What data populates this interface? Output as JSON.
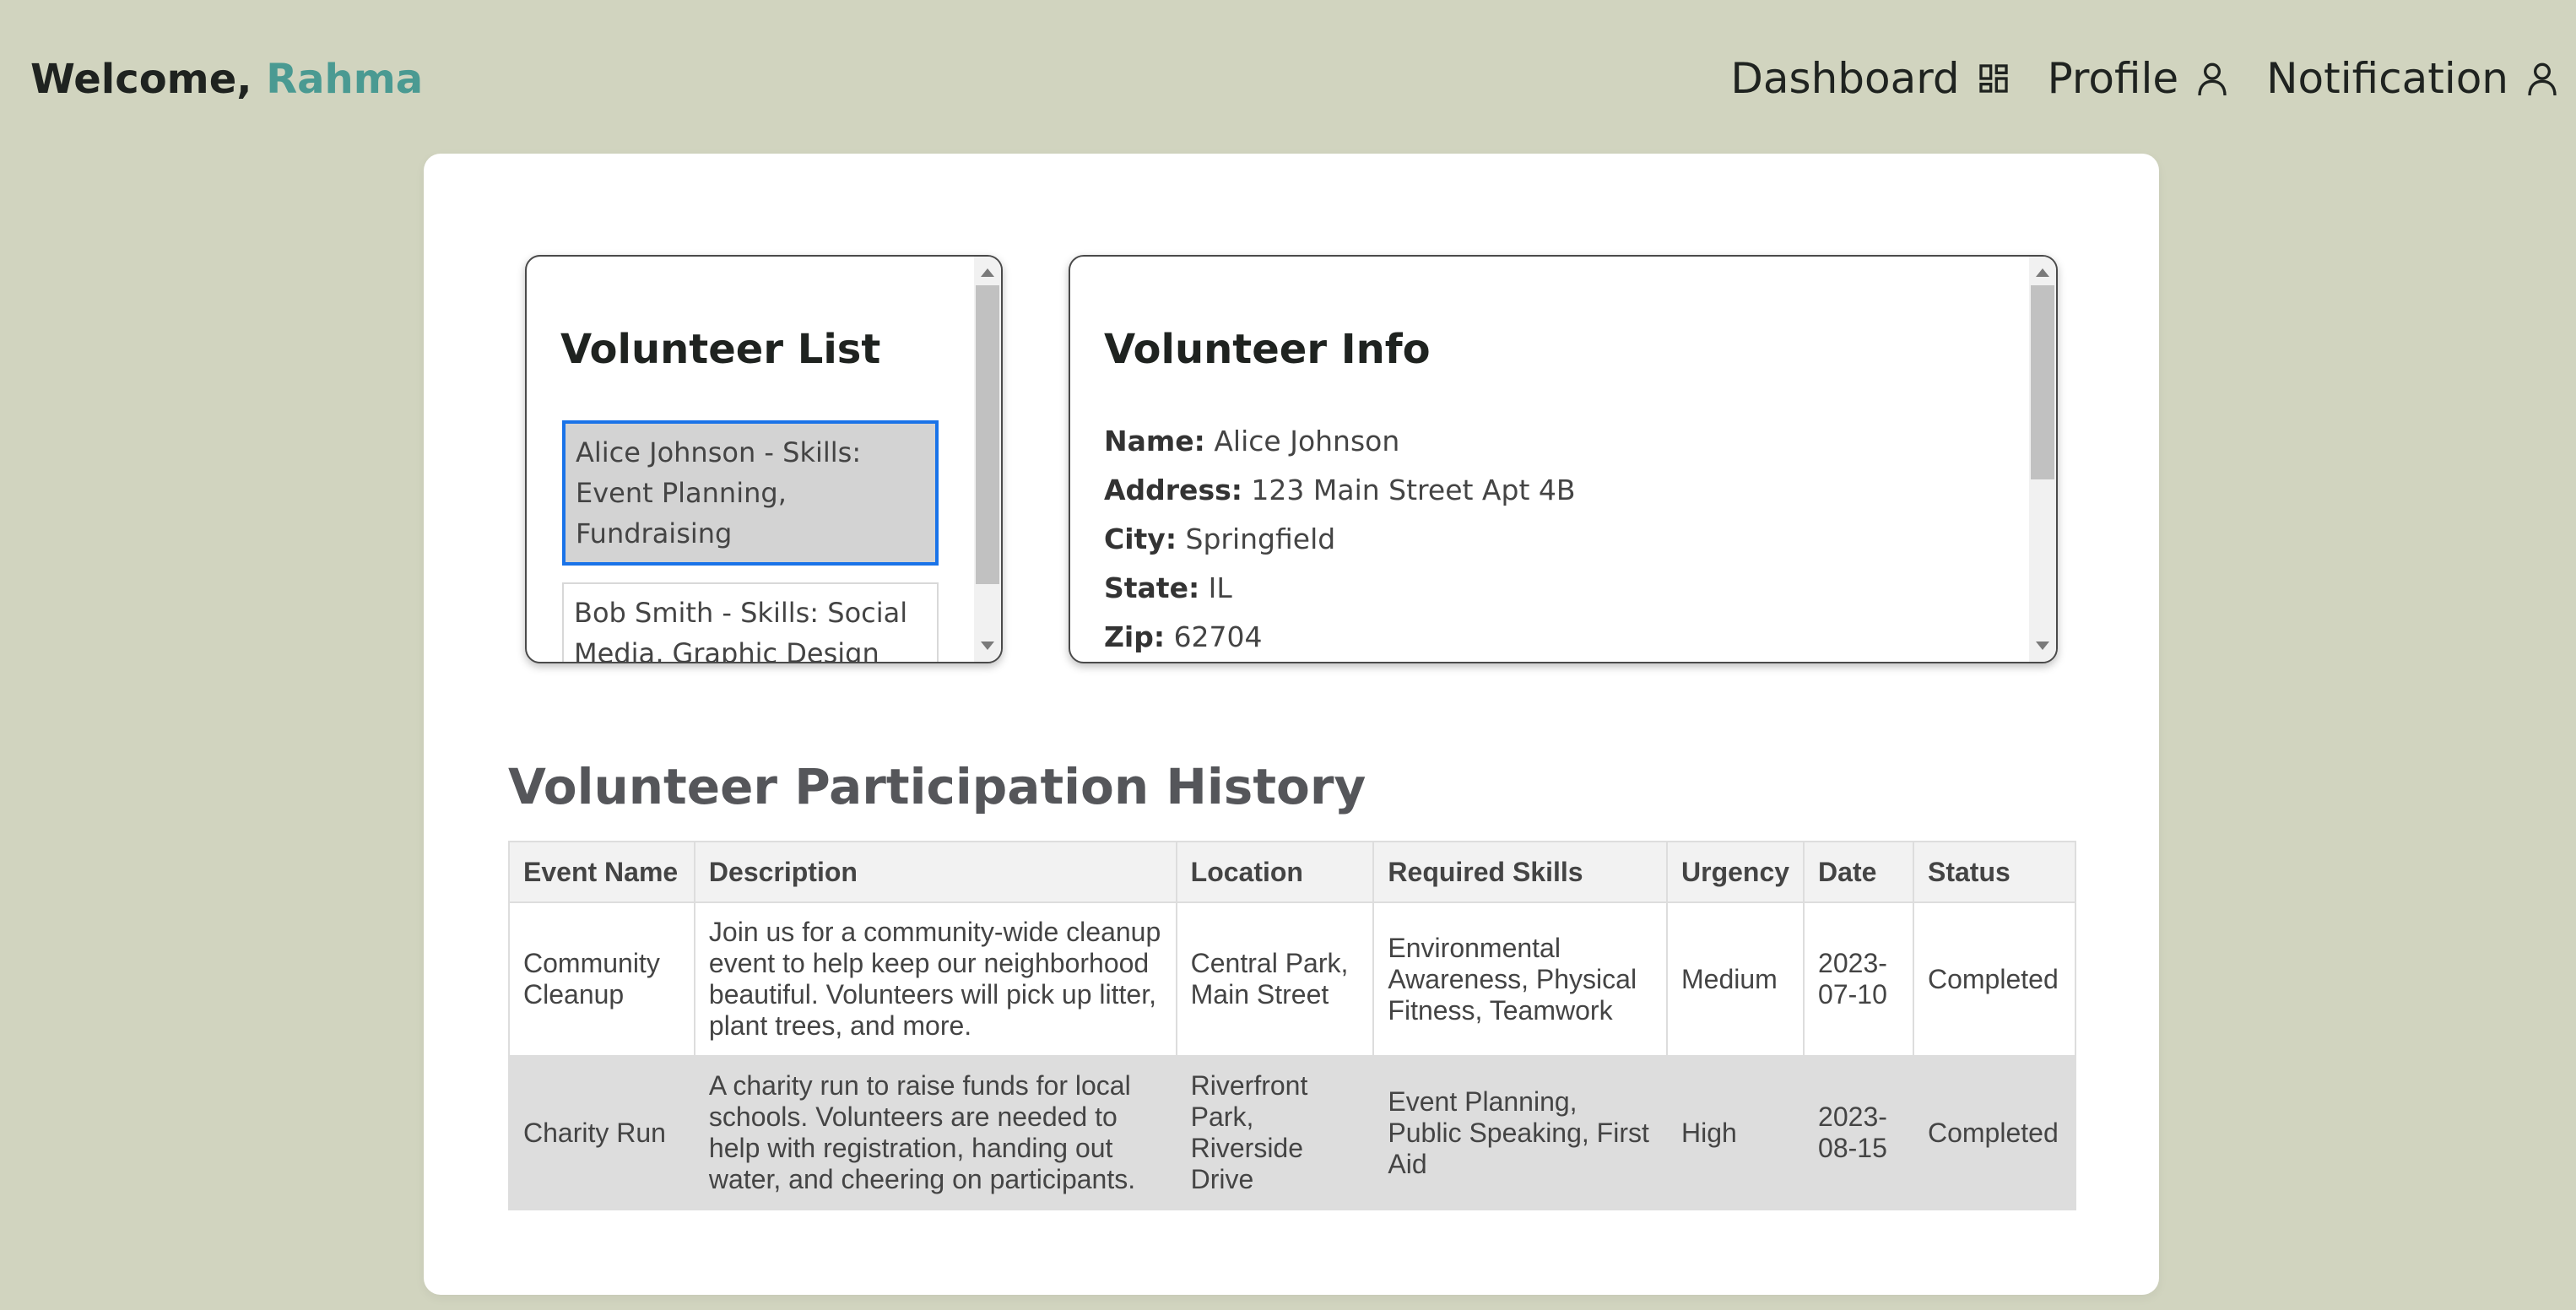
{
  "header": {
    "welcome_prefix": "Welcome, ",
    "user_name": "Rahma",
    "nav": [
      {
        "label": "Dashboard",
        "icon": "dashboard-icon"
      },
      {
        "label": "Profile",
        "icon": "user-icon"
      },
      {
        "label": "Notification",
        "icon": "user-icon"
      }
    ]
  },
  "volunteer_list": {
    "title": "Volunteer List",
    "items": [
      {
        "text": "Alice Johnson - Skills: Event Planning, Fundraising",
        "selected": true
      },
      {
        "text": "Bob Smith - Skills: Social Media, Graphic Design",
        "selected": false
      }
    ]
  },
  "volunteer_info": {
    "title": "Volunteer Info",
    "fields": [
      {
        "label": "Name:",
        "value": "Alice Johnson"
      },
      {
        "label": "Address:",
        "value": "123 Main Street Apt 4B"
      },
      {
        "label": "City:",
        "value": "Springfield"
      },
      {
        "label": "State:",
        "value": "IL"
      },
      {
        "label": "Zip:",
        "value": "62704"
      }
    ]
  },
  "history": {
    "title": "Volunteer Participation History",
    "columns": [
      "Event Name",
      "Description",
      "Location",
      "Required Skills",
      "Urgency",
      "Date",
      "Status"
    ],
    "rows": [
      [
        "Community Cleanup",
        "Join us for a community-wide cleanup event to help keep our neighborhood beautiful. Volunteers will pick up litter, plant trees, and more.",
        "Central Park, Main Street",
        "Environmental Awareness, Physical Fitness, Teamwork",
        "Medium",
        "2023-07-10",
        "Completed"
      ],
      [
        "Charity Run",
        "A charity run to raise funds for local schools. Volunteers are needed to help with registration, handing out water, and cheering on participants.",
        "Riverfront Park, Riverside Drive",
        "Event Planning, Public Speaking, First Aid",
        "High",
        "2023-08-15",
        "Completed"
      ]
    ]
  },
  "colors": {
    "background": "#d1d4bf",
    "accent": "#4a9a92",
    "selected_border": "#1a73e8"
  }
}
